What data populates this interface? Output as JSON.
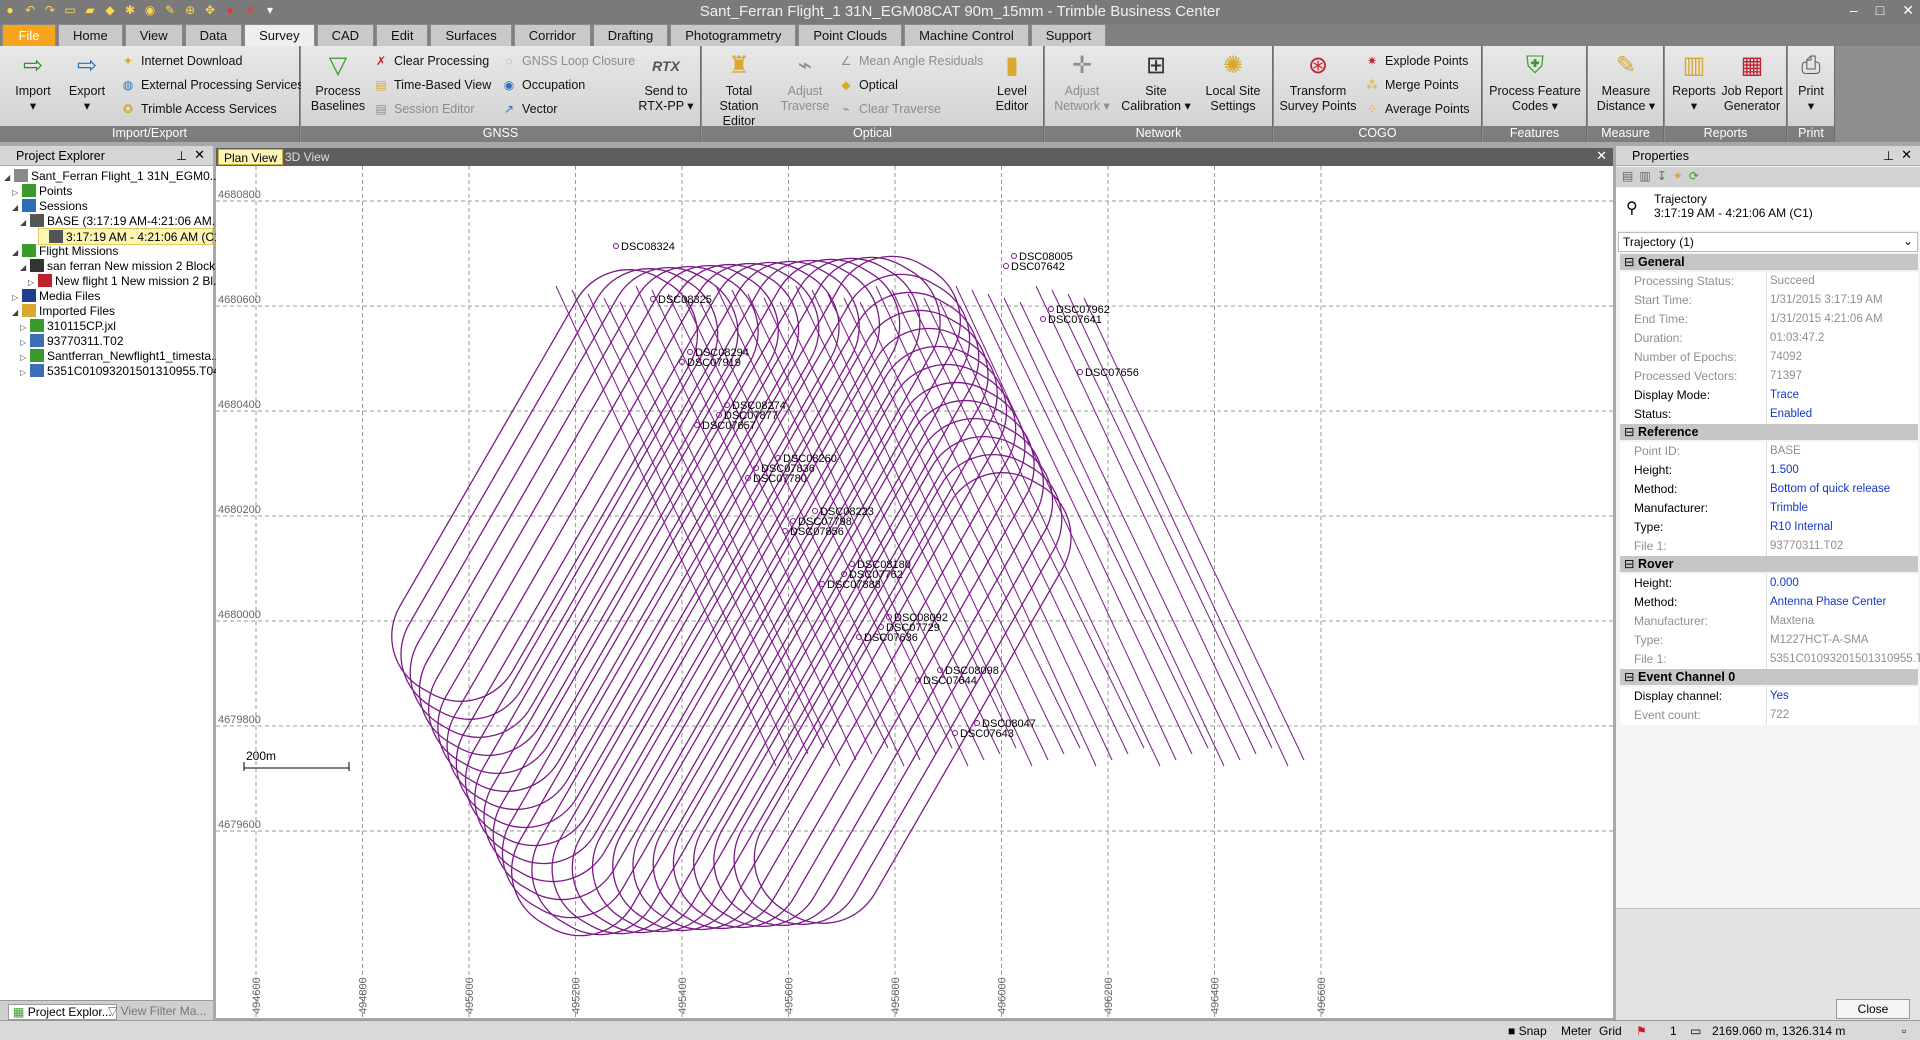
{
  "window": {
    "title": "Sant_Ferran Flight_1 31N_EGM08CAT 90m_15mm - Trimble Business Center",
    "controls": [
      "minimize-icon",
      "maximize-icon",
      "close-icon"
    ]
  },
  "ribbon_tabs": [
    "File",
    "Home",
    "View",
    "Data",
    "Survey",
    "CAD",
    "Edit",
    "Surfaces",
    "Corridor",
    "Drafting",
    "Photogrammetry",
    "Point Clouds",
    "Machine Control",
    "Support"
  ],
  "active_tab": "Survey",
  "ribbon": {
    "import_export": {
      "label": "Import/Export",
      "import": "Import",
      "export": "Export",
      "internet_download": "Internet Download",
      "external_processing": "External Processing Services",
      "trimble_access": "Trimble Access Services"
    },
    "gnss": {
      "label": "GNSS",
      "process_baselines": "Process Baselines",
      "clear_processing": "Clear Processing",
      "time_based_view": "Time-Based View",
      "session_editor": "Session Editor",
      "loop_closure": "GNSS Loop Closure",
      "occupation": "Occupation",
      "vector": "Vector",
      "send_rtx": "Send to RTX-PP",
      "rtx_label": "RTX"
    },
    "optical": {
      "label": "Optical",
      "total_station": "Total Station Editor",
      "adjust_traverse": "Adjust Traverse",
      "mean_angle": "Mean Angle Residuals",
      "optical": "Optical",
      "clear_traverse": "Clear Traverse",
      "level_editor": "Level Editor"
    },
    "network": {
      "label": "Network",
      "adjust_network": "Adjust Network",
      "site_calibration": "Site Calibration",
      "local_site": "Local Site Settings"
    },
    "cogo": {
      "label": "COGO",
      "transform": "Transform Survey Points",
      "explode": "Explode Points",
      "merge": "Merge Points",
      "average": "Average Points"
    },
    "features": {
      "label": "Features",
      "process_codes": "Process Feature Codes"
    },
    "measure": {
      "label": "Measure",
      "measure_distance": "Measure Distance"
    },
    "reports": {
      "label": "Reports",
      "reports": "Reports",
      "job_report": "Job Report Generator"
    },
    "print": {
      "label": "Print",
      "print": "Print"
    }
  },
  "project_explorer": {
    "title": "Project Explorer",
    "items": [
      {
        "label": "Sant_Ferran Flight_1  31N_EGM0...",
        "level": 0,
        "icon": "project-icon",
        "color": "#8a8a8a"
      },
      {
        "label": "Points",
        "level": 1,
        "icon": "points-icon",
        "color": "#3a9a2c"
      },
      {
        "label": "Sessions",
        "level": 1,
        "icon": "sessions-icon",
        "color": "#2b6fb8"
      },
      {
        "label": "BASE  (3:17:19 AM-4:21:06 AM...",
        "level": 2,
        "icon": "base-receiver-icon",
        "color": "#555555"
      },
      {
        "label": "3:17:19 AM - 4:21:06 AM (C1)",
        "level": 3,
        "icon": "trajectory-icon",
        "color": "#555555",
        "selected": true
      },
      {
        "label": "Flight Missions",
        "level": 1,
        "icon": "flight-missions-icon",
        "color": "#3a9a2c"
      },
      {
        "label": "san ferran New mission 2 Block",
        "level": 2,
        "icon": "drone-icon",
        "color": "#333333"
      },
      {
        "label": "New flight 1 New mission 2 Bl...",
        "level": 3,
        "icon": "flight-path-icon",
        "color": "#c0202a"
      },
      {
        "label": "Media Files",
        "level": 1,
        "icon": "media-files-icon",
        "color": "#1f3f8c"
      },
      {
        "label": "Imported Files",
        "level": 1,
        "icon": "folder-icon",
        "color": "#d9a82c"
      },
      {
        "label": "310115CP.jxl",
        "level": 2,
        "icon": "file-icon",
        "color": "#3a9a2c"
      },
      {
        "label": "93770311.T02",
        "level": 2,
        "icon": "file-icon",
        "color": "#3a6fb8"
      },
      {
        "label": "Santferran_Newflight1_timesta...",
        "level": 2,
        "icon": "file-icon",
        "color": "#3a9a2c"
      },
      {
        "label": "5351C01093201501310955.T04",
        "level": 2,
        "icon": "file-icon",
        "color": "#3a6fb8"
      }
    ],
    "bottom_tabs": [
      "Project Explor...",
      "View Filter Ma..."
    ]
  },
  "view_tabs": [
    "Plan View",
    "3D View"
  ],
  "plan_view": {
    "northings": [
      "4680800",
      "4680600",
      "4680400",
      "4680200",
      "4680000",
      "4679800",
      "4679600"
    ],
    "eastings": [
      "494600",
      "494800",
      "495000",
      "495200",
      "495400",
      "495600",
      "495800",
      "496000",
      "496200",
      "496400",
      "496600"
    ],
    "scale_label": "200m",
    "trajectory_color": "#7b1a86",
    "photo_labels": [
      "DSC08324",
      "DSC08325",
      "DSC08294",
      "DSC08274",
      "DSC08260",
      "DSC08223",
      "DSC08180",
      "DSC08092",
      "DSC08098",
      "DSC08047",
      "DSC08005",
      "DSC07962",
      "DSC07919",
      "DSC07877",
      "DSC07836",
      "DSC07798",
      "DSC07762",
      "DSC07729",
      "DSC07644",
      "DSC07643",
      "DSC07642",
      "DSC07641",
      "DSC07656",
      "DSC07657",
      "DSC07780",
      "DSC07856",
      "DSC07888",
      "DSC07636"
    ]
  },
  "properties": {
    "title": "Properties",
    "object_type": "Trajectory",
    "object_time": "3:17:19 AM - 4:21:06 AM (C1)",
    "selector": "Trajectory (1)",
    "sections": [
      {
        "name": "General",
        "rows": [
          {
            "k": "Processing Status:",
            "v": "Succeed",
            "edit": false
          },
          {
            "k": "Start Time:",
            "v": "1/31/2015 3:17:19 AM",
            "edit": false
          },
          {
            "k": "End Time:",
            "v": "1/31/2015 4:21:06 AM",
            "edit": false
          },
          {
            "k": "Duration:",
            "v": "01:03:47.2",
            "edit": false
          },
          {
            "k": "Number of Epochs:",
            "v": "74092",
            "edit": false
          },
          {
            "k": "Processed Vectors:",
            "v": "71397",
            "edit": false
          },
          {
            "k": "Display Mode:",
            "v": "Trace",
            "edit": true
          },
          {
            "k": "Status:",
            "v": "Enabled",
            "edit": true
          }
        ]
      },
      {
        "name": "Reference",
        "rows": [
          {
            "k": "Point ID:",
            "v": "BASE",
            "edit": false
          },
          {
            "k": "Height:",
            "v": "1.500",
            "edit": true
          },
          {
            "k": "Method:",
            "v": "Bottom of quick release",
            "edit": true
          },
          {
            "k": "Manufacturer:",
            "v": "Trimble",
            "edit": true
          },
          {
            "k": "Type:",
            "v": "R10 Internal",
            "edit": true
          },
          {
            "k": "File 1:",
            "v": "93770311.T02",
            "edit": false
          }
        ]
      },
      {
        "name": "Rover",
        "rows": [
          {
            "k": "Height:",
            "v": "0.000",
            "edit": true
          },
          {
            "k": "Method:",
            "v": "Antenna Phase Center",
            "edit": true
          },
          {
            "k": "Manufacturer:",
            "v": "Maxtena",
            "edit": false
          },
          {
            "k": "Type:",
            "v": "M1227HCT-A-SMA",
            "edit": false
          },
          {
            "k": "File 1:",
            "v": "5351C01093201501310955.T",
            "edit": false
          }
        ]
      },
      {
        "name": "Event Channel 0",
        "rows": [
          {
            "k": "Display channel:",
            "v": "Yes",
            "edit": true
          },
          {
            "k": "Event count:",
            "v": "722",
            "edit": false
          }
        ]
      }
    ],
    "close_label": "Close"
  },
  "statusbar": {
    "snap": "Snap",
    "units": "Meter",
    "grid": "Grid",
    "count": "1",
    "coords": "2169.060 m, 1326.314 m"
  }
}
